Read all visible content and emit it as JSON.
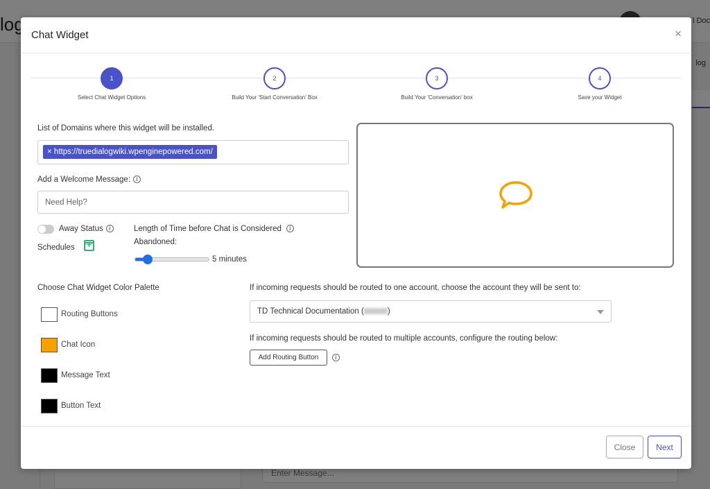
{
  "modal": {
    "title": "Chat Widget",
    "close_symbol": "×",
    "steps": [
      {
        "number": "1",
        "label": "Select Chat Widget Options",
        "active": true
      },
      {
        "number": "2",
        "label": "Build Your 'Start Conversation' Box",
        "active": false
      },
      {
        "number": "3",
        "label": "Build Your 'Conversation' box",
        "active": false
      },
      {
        "number": "4",
        "label": "Save your Widget",
        "active": false
      }
    ],
    "domains": {
      "label": "List of Domains where this widget will be installed.",
      "tags": [
        {
          "remove_symbol": "×",
          "value": "https://truedialogwiki.wpenginepowered.com/"
        }
      ]
    },
    "welcome": {
      "label": "Add a Welcome Message:",
      "placeholder": "Need Help?",
      "value": ""
    },
    "away": {
      "label": "Away Status",
      "enabled": false,
      "schedules_label": "Schedules"
    },
    "abandon": {
      "label_line1": "Length of Time before Chat is Considered",
      "label_line2": "Abandoned:",
      "value_text": "5 minutes",
      "slider_fraction": 0.17
    },
    "preview": {
      "icon": "chat-bubble-icon",
      "icon_color": "#f5a100"
    },
    "palette": {
      "title": "Choose Chat Widget Color Palette",
      "items": [
        {
          "label": "Routing Buttons",
          "color": "#ffffff"
        },
        {
          "label": "Chat Icon",
          "color": "#f5a100"
        },
        {
          "label": "Message Text",
          "color": "#000000"
        },
        {
          "label": "Button Text",
          "color": "#000000"
        }
      ]
    },
    "routing": {
      "single_label": "If incoming requests should be routed to one account, choose the account they will be sent to:",
      "selected_account": "TD Technical Documentation (",
      "selected_account_suffix": ")",
      "multi_label": "If incoming requests should be routed to multiple accounts, configure the routing below:",
      "add_button": "Add Routing Button"
    },
    "footer": {
      "close": "Close",
      "next": "Next"
    },
    "accent_color": "#4a52c8"
  },
  "background": {
    "logo_fragment": "log",
    "user_fragment": "l Doc",
    "crumb_fragment": "log",
    "message_placeholder": "Enter Message..."
  }
}
